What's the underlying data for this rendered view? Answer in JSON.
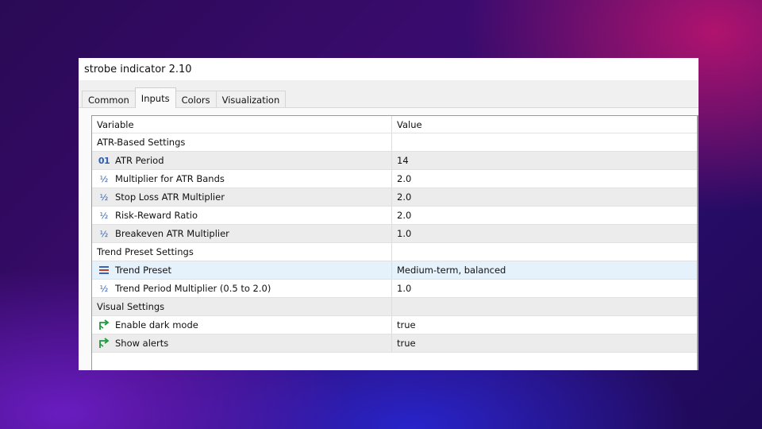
{
  "window": {
    "title": "strobe indicator 2.10"
  },
  "tabs": [
    {
      "label": "Common",
      "active": false
    },
    {
      "label": "Inputs",
      "active": true
    },
    {
      "label": "Colors",
      "active": false
    },
    {
      "label": "Visualization",
      "active": false
    }
  ],
  "table": {
    "columns": {
      "variable": "Variable",
      "value": "Value"
    },
    "rows": [
      {
        "type": "section",
        "label": "ATR-Based Settings",
        "value": ""
      },
      {
        "type": "param",
        "icon": "integer-icon",
        "label": "ATR Period",
        "value": "14"
      },
      {
        "type": "param",
        "icon": "double-icon",
        "label": "Multiplier for ATR Bands",
        "value": "2.0"
      },
      {
        "type": "param",
        "icon": "double-icon",
        "label": "Stop Loss ATR Multiplier",
        "value": "2.0"
      },
      {
        "type": "param",
        "icon": "double-icon",
        "label": "Risk-Reward Ratio",
        "value": "2.0"
      },
      {
        "type": "param",
        "icon": "double-icon",
        "label": "Breakeven ATR Multiplier",
        "value": "1.0"
      },
      {
        "type": "section",
        "label": "Trend Preset Settings",
        "value": ""
      },
      {
        "type": "param",
        "icon": "enum-list-icon",
        "label": "Trend Preset",
        "value": "Medium-term, balanced",
        "selected": true
      },
      {
        "type": "param",
        "icon": "double-icon",
        "label": "Trend Period Multiplier (0.5 to 2.0)",
        "value": "1.0"
      },
      {
        "type": "section",
        "label": "Visual Settings",
        "value": ""
      },
      {
        "type": "param",
        "icon": "bool-arrow-icon",
        "label": "Enable dark mode",
        "value": "true"
      },
      {
        "type": "param",
        "icon": "bool-arrow-icon",
        "label": "Show alerts",
        "value": "true"
      }
    ]
  },
  "icons": {
    "integer-icon": "01",
    "double-icon": "½",
    "enum-list-icon": "≡",
    "bool-arrow-icon": "↱"
  },
  "colors": {
    "icon_blue": "#2a5db0",
    "icon_green": "#1a9a3a",
    "enum_red": "#c0392b",
    "selected_row": "#e5f1fb"
  }
}
